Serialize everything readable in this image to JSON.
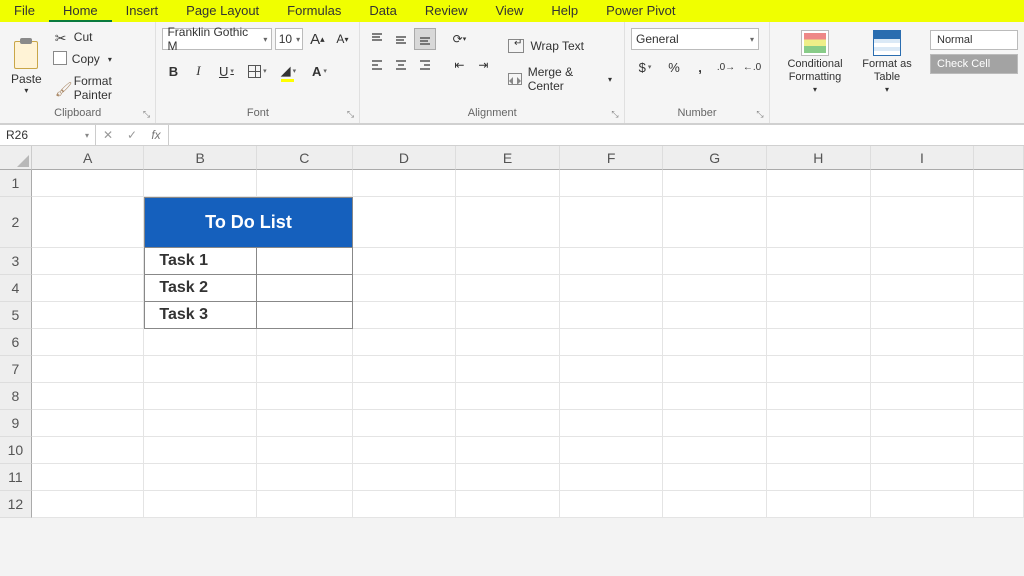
{
  "menu": {
    "file": "File",
    "home": "Home",
    "insert": "Insert",
    "pageLayout": "Page Layout",
    "formulas": "Formulas",
    "data": "Data",
    "review": "Review",
    "view": "View",
    "help": "Help",
    "powerPivot": "Power Pivot"
  },
  "clipboard": {
    "paste": "Paste",
    "cut": "Cut",
    "copy": "Copy",
    "formatPainter": "Format Painter",
    "label": "Clipboard"
  },
  "font": {
    "name": "Franklin Gothic M",
    "size": "10",
    "increase": "A",
    "decrease": "A",
    "bold": "B",
    "italic": "I",
    "underline": "U",
    "fill": "🪣",
    "color": "A",
    "label": "Font"
  },
  "alignment": {
    "wrap": "Wrap Text",
    "merge": "Merge & Center",
    "label": "Alignment"
  },
  "number": {
    "format": "General",
    "label": "Number",
    "dollar": "$",
    "percent": "%",
    "comma": ",",
    "inc": ".0",
    "dec": ".00"
  },
  "styles": {
    "cond": "Conditional Formatting",
    "table": "Format as Table",
    "normal": "Normal",
    "check": "Check Cell"
  },
  "fx": {
    "name": "R26",
    "x": "✕",
    "chk": "✓",
    "fx": "fx"
  },
  "cols": [
    "A",
    "B",
    "C",
    "D",
    "E",
    "F",
    "G",
    "H",
    "I"
  ],
  "rows": [
    "1",
    "2",
    "3",
    "4",
    "5",
    "6",
    "7",
    "8",
    "9",
    "10",
    "11",
    "12"
  ],
  "sheet": {
    "header": "To Do List",
    "tasks": [
      "Task 1",
      "Task 2",
      "Task 3"
    ]
  }
}
